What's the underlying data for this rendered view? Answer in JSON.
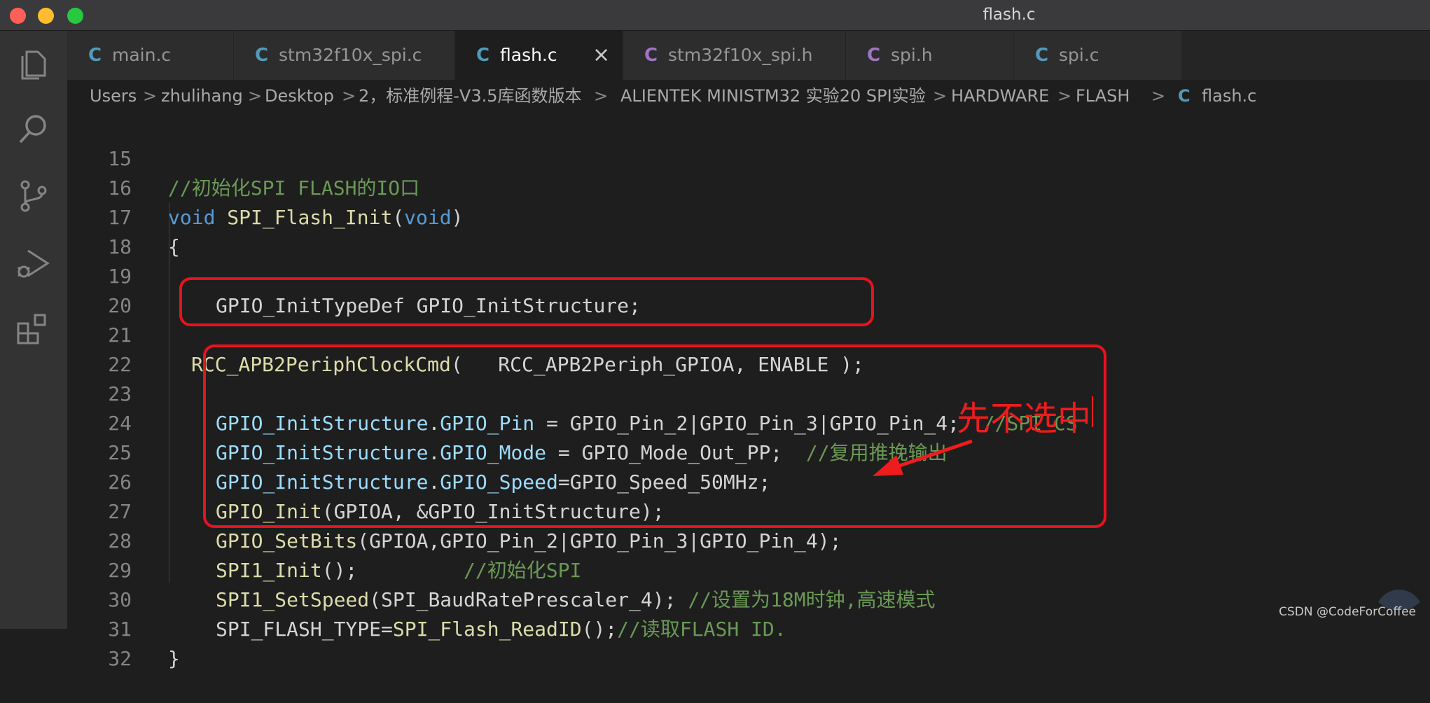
{
  "window": {
    "title": "flash.c",
    "traffic_lights": {
      "close": "#fe5f57",
      "minimize": "#febc2e",
      "zoom": "#28c840"
    }
  },
  "activity_bar": [
    {
      "name": "explorer-icon"
    },
    {
      "name": "search-icon"
    },
    {
      "name": "source-control-icon"
    },
    {
      "name": "run-debug-icon"
    },
    {
      "name": "extensions-icon"
    }
  ],
  "tabs": [
    {
      "icon": "C",
      "label": "main.c",
      "color": "#519aba",
      "active": false
    },
    {
      "icon": "C",
      "label": "stm32f10x_spi.c",
      "color": "#519aba",
      "active": false
    },
    {
      "icon": "C",
      "label": "flash.c",
      "color": "#519aba",
      "active": true,
      "close": "×"
    },
    {
      "icon": "C",
      "label": "stm32f10x_spi.h",
      "color": "#a074c4",
      "active": false
    },
    {
      "icon": "C",
      "label": "spi.h",
      "color": "#a074c4",
      "active": false
    },
    {
      "icon": "C",
      "label": "spi.c",
      "color": "#519aba",
      "active": false
    }
  ],
  "breadcrumb": {
    "parts": [
      "Users",
      "zhulihang",
      "Desktop",
      "2，标准例程-V3.5库函数版本",
      "ALIENTEK MINISTM32 实验20 SPI实验",
      "HARDWARE",
      "FLASH"
    ],
    "file_icon": "C",
    "file": "flash.c",
    "separator": ">"
  },
  "code": {
    "line_numbers": [
      "15",
      "16",
      "17",
      "18",
      "19",
      "20",
      "21",
      "22",
      "23",
      "24",
      "25",
      "26",
      "27",
      "28",
      "29",
      "30",
      "31",
      "32"
    ],
    "lines": {
      "l15": {
        "comment": "//初始化SPI FLASH的IO口"
      },
      "l16": {
        "kw1": "void",
        "fn": "SPI_Flash_Init",
        "p1": "(",
        "kw2": "void",
        "p2": ")"
      },
      "l17": {
        "text": "{"
      },
      "l19": {
        "text": "GPIO_InitTypeDef GPIO_InitStructure;"
      },
      "l21": {
        "fn": "RCC_APB2PeriphClockCmd",
        "rest": "(   RCC_APB2Periph_GPIOA, ENABLE );"
      },
      "l23": {
        "v1": "GPIO_InitStructure",
        "dot": ".",
        "v2": "GPIO_Pin",
        "rest": " = GPIO_Pin_2|GPIO_Pin_3|GPIO_Pin_4;  ",
        "comment": "//SPI CS"
      },
      "l24": {
        "v1": "GPIO_InitStructure",
        "dot": ".",
        "v2": "GPIO_Mode",
        "rest": " = GPIO_Mode_Out_PP;  ",
        "comment": "//复用推挽输出"
      },
      "l25": {
        "v1": "GPIO_InitStructure",
        "dot": ".",
        "v2": "GPIO_Speed",
        "rest": "=GPIO_Speed_50MHz;"
      },
      "l26": {
        "fn": "GPIO_Init",
        "rest": "(GPIOA, &GPIO_InitStructure);"
      },
      "l27": {
        "fn": "GPIO_SetBits",
        "rest": "(GPIOA,GPIO_Pin_2|GPIO_Pin_3|GPIO_Pin_4);"
      },
      "l28": {
        "fn": "SPI1_Init",
        "rest": "();         ",
        "comment": "//初始化SPI"
      },
      "l29": {
        "fn": "SPI1_SetSpeed",
        "rest": "(SPI_BaudRatePrescaler_4); ",
        "comment": "//设置为18M时钟,高速模式"
      },
      "l30": {
        "pre": "SPI_FLASH_TYPE=",
        "fn": "SPI_Flash_ReadID",
        "rest": "();",
        "comment": "//读取FLASH ID."
      },
      "l31": {
        "text": "}"
      }
    }
  },
  "annotation": {
    "text": "先不选中",
    "color": "#ee1c1c"
  },
  "watermark": "CSDN @CodeForCoffee"
}
